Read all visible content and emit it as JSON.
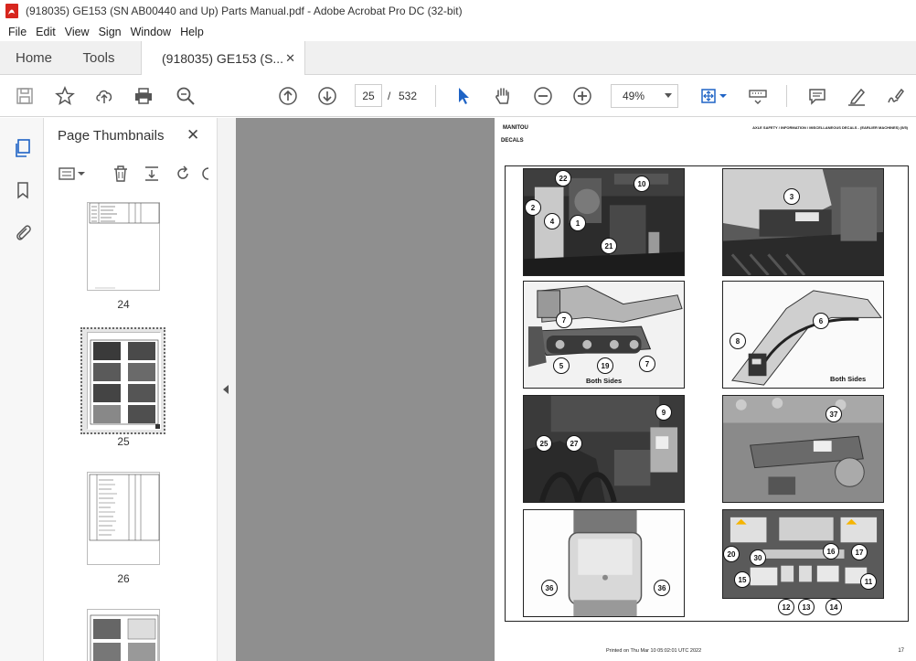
{
  "window": {
    "title": "(918035) GE153 (SN AB00440 and Up) Parts Manual.pdf - Adobe Acrobat Pro DC (32-bit)"
  },
  "menu": [
    "File",
    "Edit",
    "View",
    "Sign",
    "Window",
    "Help"
  ],
  "tabs": {
    "home": "Home",
    "tools": "Tools",
    "document": "(918035) GE153 (S...",
    "close": "✕"
  },
  "toolbar": {
    "page_current": "25",
    "page_separator": "/",
    "page_total": "532",
    "zoom": "49%",
    "icons": [
      "save-icon",
      "bookmark-star-icon",
      "upload-icon",
      "print-icon",
      "search-zoom-icon",
      "page-up-icon",
      "page-down-icon",
      "select-arrow-icon",
      "hand-icon",
      "zoom-out-icon",
      "zoom-in-icon",
      "fit-page-icon",
      "keyboard-icon",
      "comment-icon",
      "highlight-icon",
      "sign-icon"
    ]
  },
  "panel": {
    "title": "Page Thumbnails",
    "close": "✕",
    "thumbnails": [
      {
        "label": "24"
      },
      {
        "label": "25",
        "selected": true
      },
      {
        "label": "26"
      },
      {
        "label": ""
      }
    ]
  },
  "pdf": {
    "brand": "MANITOU",
    "section": "DECALS",
    "breadcrumb": "AXLE SAFETY / INFORMATION / MISCELLANEOUS DECALS - (EARLIER MACHINES) (5/5)",
    "captions": {
      "both_sides_1": "Both Sides",
      "both_sides_2": "Both Sides"
    },
    "callouts": {
      "p1": [
        "22",
        "10",
        "2",
        "4",
        "1",
        "21"
      ],
      "p2": [
        "3"
      ],
      "p3": [
        "7",
        "5",
        "19",
        "7"
      ],
      "p4": [
        "6",
        "8"
      ],
      "p5": [
        "9",
        "25",
        "27"
      ],
      "p6": [
        "37"
      ],
      "p7": [
        "36",
        "36"
      ],
      "p8": [
        "20",
        "16",
        "17",
        "30",
        "15",
        "11",
        "12",
        "13",
        "14"
      ]
    },
    "footer_printed": "Printed on  Thu Mar 10 05:02:01 UTC 2022",
    "footer_page": "17"
  }
}
